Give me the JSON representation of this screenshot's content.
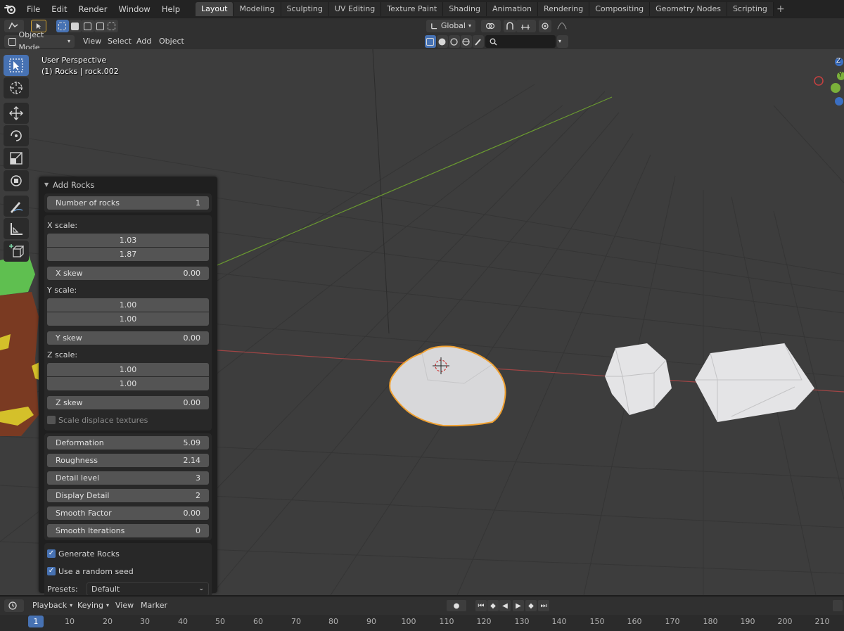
{
  "menubar": {
    "items": [
      "File",
      "Edit",
      "Render",
      "Window",
      "Help"
    ]
  },
  "workspaces": {
    "tabs": [
      "Layout",
      "Modeling",
      "Sculpting",
      "UV Editing",
      "Texture Paint",
      "Shading",
      "Animation",
      "Rendering",
      "Compositing",
      "Geometry Nodes",
      "Scripting"
    ],
    "active": "Layout"
  },
  "toolheader": {
    "orientation": "Global"
  },
  "viewheader": {
    "mode": "Object Mode",
    "view": "View",
    "select": "Select",
    "add": "Add",
    "object": "Object"
  },
  "viewport": {
    "perspective": "User Perspective",
    "selection": "(1) Rocks | rock.002",
    "gizmo_z": "Z",
    "gizmo_y": "Y"
  },
  "panel": {
    "title": "Add Rocks",
    "number_of_rocks": {
      "label": "Number of rocks",
      "value": "1"
    },
    "x_scale": {
      "label": "X scale:",
      "min": "1.03",
      "max": "1.87"
    },
    "x_skew": {
      "label": "X skew",
      "value": "0.00"
    },
    "y_scale": {
      "label": "Y scale:",
      "min": "1.00",
      "max": "1.00"
    },
    "y_skew": {
      "label": "Y skew",
      "value": "0.00"
    },
    "z_scale": {
      "label": "Z scale:",
      "min": "1.00",
      "max": "1.00"
    },
    "z_skew": {
      "label": "Z skew",
      "value": "0.00"
    },
    "scale_displace": {
      "label": "Scale displace textures",
      "checked": false
    },
    "deformation": {
      "label": "Deformation",
      "value": "5.09"
    },
    "roughness": {
      "label": "Roughness",
      "value": "2.14"
    },
    "detail_level": {
      "label": "Detail level",
      "value": "3"
    },
    "display_detail": {
      "label": "Display Detail",
      "value": "2"
    },
    "smooth_factor": {
      "label": "Smooth Factor",
      "value": "0.00"
    },
    "smooth_iterations": {
      "label": "Smooth Iterations",
      "value": "0"
    },
    "generate_rocks": {
      "label": "Generate Rocks",
      "checked": true
    },
    "random_seed": {
      "label": "Use a random seed",
      "checked": true
    },
    "presets": {
      "label": "Presets:",
      "value": "Default"
    }
  },
  "timeline": {
    "playback": "Playback",
    "keying": "Keying",
    "view": "View",
    "marker": "Marker",
    "current_frame": "1",
    "ticks": [
      "10",
      "20",
      "30",
      "40",
      "50",
      "60",
      "70",
      "80",
      "90",
      "100",
      "110",
      "120",
      "130",
      "140",
      "150",
      "160",
      "170",
      "180",
      "190",
      "200",
      "210"
    ]
  },
  "colors": {
    "accent": "#4772b3",
    "selection_outline": "#f0a030",
    "x_axis": "#b04848",
    "y_axis": "#6a9a30"
  }
}
